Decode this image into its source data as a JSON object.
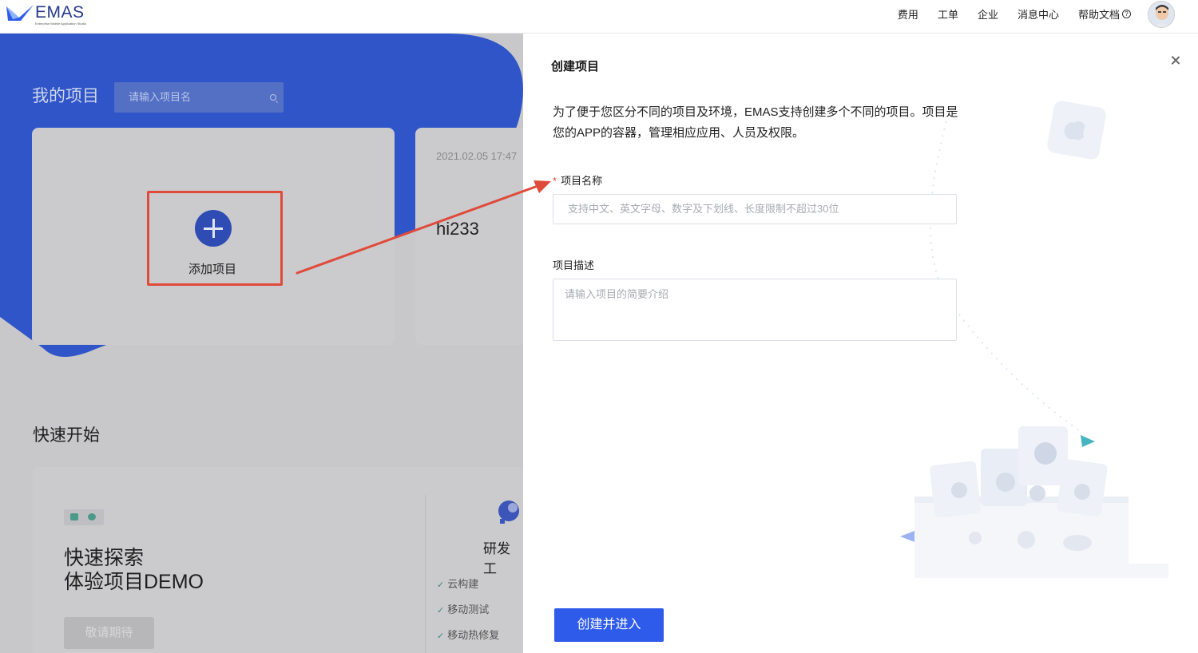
{
  "header": {
    "logo_text": "EMAS",
    "logo_subtext": "Enterprise Mobile Application Studio",
    "nav": [
      "费用",
      "工单",
      "企业",
      "消息中心",
      "帮助文档"
    ]
  },
  "projects": {
    "title": "我的项目",
    "search_placeholder": "请输入项目名",
    "add_label": "添加项目",
    "cards": [
      {
        "date": "2021.02.05 17:47",
        "name": "hi233"
      }
    ]
  },
  "quick_start": {
    "title": "快速开始",
    "demo_line1": "快速探索",
    "demo_line2": "体验项目DEMO",
    "demo_button": "敬请期待",
    "dev_title": "研发工",
    "features": [
      "云构建",
      "移动测试",
      "移动热修复"
    ]
  },
  "drawer": {
    "title": "创建项目",
    "intro": "为了便于您区分不同的项目及环境，EMAS支持创建多个不同的项目。项目是您的APP的容器，管理相应应用、人员及权限。",
    "name_label": "项目名称",
    "name_placeholder": "支持中文、英文字母、数字及下划线、长度限制不超过30位",
    "desc_label": "项目描述",
    "desc_placeholder": "请输入项目的简要介绍",
    "submit_label": "创建并进入"
  },
  "colors": {
    "brand_blue": "#2f5bea",
    "banner_blue": "#2f55c8",
    "annotation_red": "#e04a3a"
  }
}
